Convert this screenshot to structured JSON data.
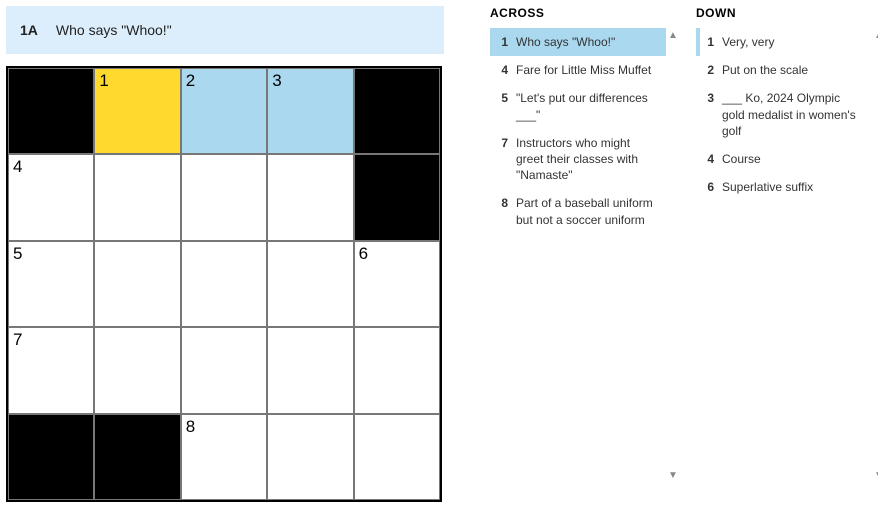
{
  "current_clue": {
    "label": "1A",
    "text": "Who says \"Whoo!\""
  },
  "grid": {
    "rows": 5,
    "cols": 5,
    "cells": [
      [
        {
          "black": true
        },
        {
          "num": "1",
          "state": "active"
        },
        {
          "num": "2",
          "state": "word"
        },
        {
          "num": "3",
          "state": "word"
        },
        {
          "black": true
        }
      ],
      [
        {
          "num": "4"
        },
        {},
        {},
        {},
        {
          "black": true
        }
      ],
      [
        {
          "num": "5"
        },
        {},
        {},
        {},
        {
          "num": "6"
        }
      ],
      [
        {
          "num": "7"
        },
        {},
        {},
        {},
        {}
      ],
      [
        {
          "black": true
        },
        {
          "black": true
        },
        {
          "num": "8"
        },
        {},
        {}
      ]
    ]
  },
  "across": {
    "heading": "ACROSS",
    "clues": [
      {
        "num": "1",
        "text": "Who says \"Whoo!\"",
        "selected": true
      },
      {
        "num": "4",
        "text": "Fare for Little Miss Muffet"
      },
      {
        "num": "5",
        "text": "\"Let's put our differences ___\""
      },
      {
        "num": "7",
        "text": "Instructors who might greet their classes with \"Namaste\""
      },
      {
        "num": "8",
        "text": "Part of a baseball uniform but not a soccer uniform"
      }
    ]
  },
  "down": {
    "heading": "DOWN",
    "clues": [
      {
        "num": "1",
        "text": "Very, very",
        "cursor": true
      },
      {
        "num": "2",
        "text": "Put on the scale"
      },
      {
        "num": "3",
        "text": "___ Ko, 2024 Olympic gold medalist in women's golf"
      },
      {
        "num": "4",
        "text": "Course"
      },
      {
        "num": "6",
        "text": "Superlative suffix"
      }
    ]
  },
  "chart_data": {
    "type": "table",
    "title": "5x5 crossword grid",
    "rows": 5,
    "cols": 5,
    "black_cells": [
      [
        0,
        0
      ],
      [
        0,
        4
      ],
      [
        1,
        4
      ],
      [
        4,
        0
      ],
      [
        4,
        1
      ]
    ],
    "numbered_cells": {
      "1": [
        0,
        1
      ],
      "2": [
        0,
        2
      ],
      "3": [
        0,
        3
      ],
      "4": [
        1,
        0
      ],
      "5": [
        2,
        0
      ],
      "6": [
        2,
        4
      ],
      "7": [
        3,
        0
      ],
      "8": [
        4,
        2
      ]
    },
    "highlighted_word_cells": [
      [
        0,
        1
      ],
      [
        0,
        2
      ],
      [
        0,
        3
      ]
    ],
    "active_cell": [
      0,
      1
    ]
  }
}
